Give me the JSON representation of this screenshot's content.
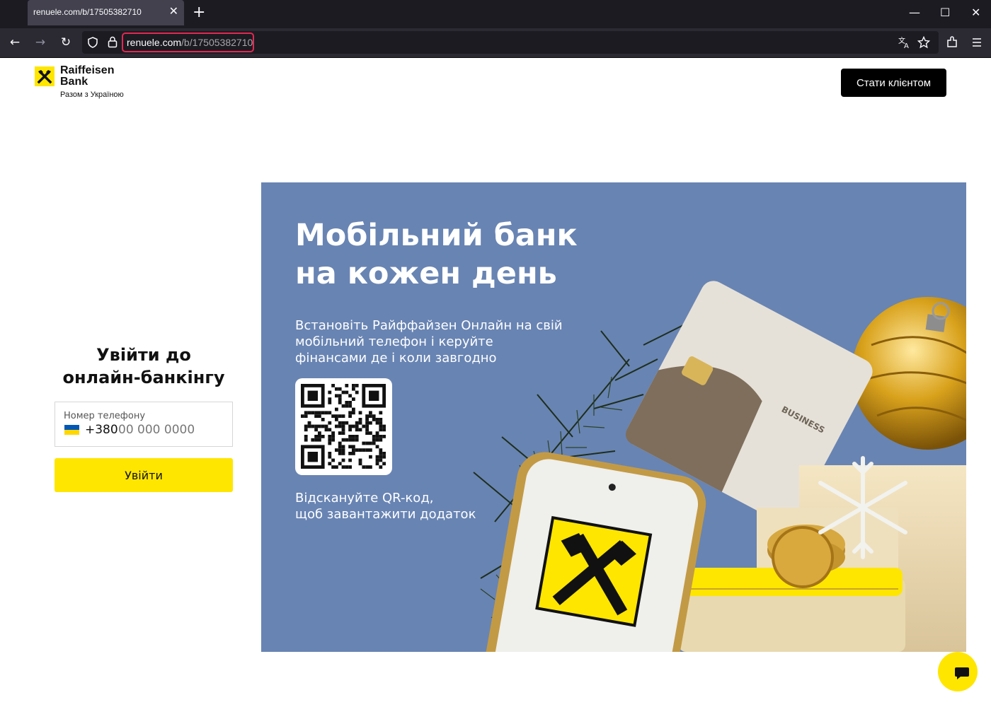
{
  "browser": {
    "tab_title": "renuele.com/b/17505382710",
    "tab_close": "✕",
    "new_tab": "+",
    "url_host": "renuele.com",
    "url_path": "/b/17505382710",
    "min": "—",
    "max": "☐",
    "close": "✕",
    "back": "←",
    "forward": "→",
    "reload": "↻"
  },
  "header": {
    "brand_line1": "Raiffeisen",
    "brand_line2": "Bank",
    "slogan": "Разом з Україною",
    "cta": "Стати клієнтом"
  },
  "login": {
    "title": "Увійти до онлайн-банкінгу",
    "phone_label": "Номер телефону",
    "phone_code": "+380",
    "phone_placeholder": "00 000 0000",
    "submit": "Увійти"
  },
  "banner": {
    "title": "Мобільний банк\nна кожен день",
    "text": "Встановіть Райффайзен Онлайн на свій\nмобільний телефон і керуйте\nфінансами де і коли завгодно",
    "scan_text": "Відскануйте QR-код,\nщоб завантажити додаток",
    "card_label": "BUSINESS"
  },
  "colors": {
    "brand_yellow": "#fee600",
    "banner_blue": "#6884b3"
  },
  "icons": {
    "chat": "chat-bubble-icon"
  }
}
